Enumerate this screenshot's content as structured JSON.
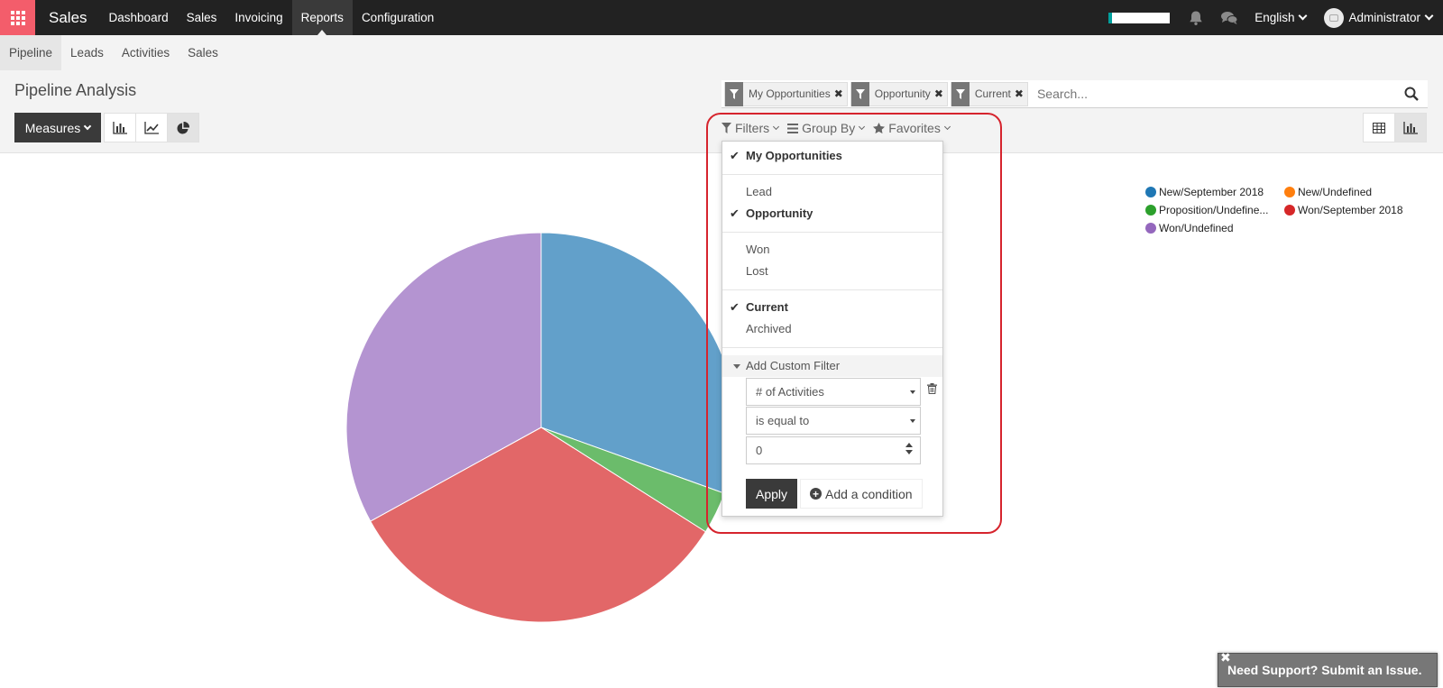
{
  "app": {
    "brand": "Sales"
  },
  "top_menu": [
    "Dashboard",
    "Sales",
    "Invoicing",
    "Reports",
    "Configuration"
  ],
  "top_menu_active": "Reports",
  "top_right": {
    "language": "English",
    "user": "Administrator"
  },
  "sub_menu": [
    "Pipeline",
    "Leads",
    "Activities",
    "Sales"
  ],
  "sub_menu_active": "Pipeline",
  "page": {
    "title": "Pipeline Analysis",
    "measures_label": "Measures"
  },
  "search": {
    "facets": [
      {
        "label": "My Opportunities"
      },
      {
        "label": "Opportunity"
      },
      {
        "label": "Current"
      }
    ],
    "placeholder": "Search..."
  },
  "filter_toggles": {
    "filters": "Filters",
    "group_by": "Group By",
    "favorites": "Favorites"
  },
  "filters_dropdown": {
    "groups": [
      [
        {
          "label": "My Opportunities",
          "checked": true
        }
      ],
      [
        {
          "label": "Lead",
          "checked": false
        },
        {
          "label": "Opportunity",
          "checked": true
        }
      ],
      [
        {
          "label": "Won",
          "checked": false
        },
        {
          "label": "Lost",
          "checked": false
        }
      ],
      [
        {
          "label": "Current",
          "checked": true
        },
        {
          "label": "Archived",
          "checked": false
        }
      ]
    ],
    "custom_filter": {
      "header": "Add Custom Filter",
      "field": "# of Activities",
      "operator": "is equal to",
      "value": "0",
      "apply": "Apply",
      "add_condition": "Add a condition"
    }
  },
  "chart_data": {
    "type": "pie",
    "title": "",
    "legend_position": "top-right",
    "series": [
      {
        "name": "New/September 2018",
        "value": 30.5,
        "color": "#1f77b4"
      },
      {
        "name": "New/Undefined",
        "value": 0,
        "color": "#ff7f0e"
      },
      {
        "name": "Proposition/Undefine...",
        "value": 3.5,
        "color": "#2ca02c"
      },
      {
        "name": "Won/September 2018",
        "value": 33.0,
        "color": "#d62728"
      },
      {
        "name": "Won/Undefined",
        "value": 33.0,
        "color": "#9467bd"
      }
    ]
  },
  "support": {
    "label": "Need Support? Submit an Issue."
  }
}
